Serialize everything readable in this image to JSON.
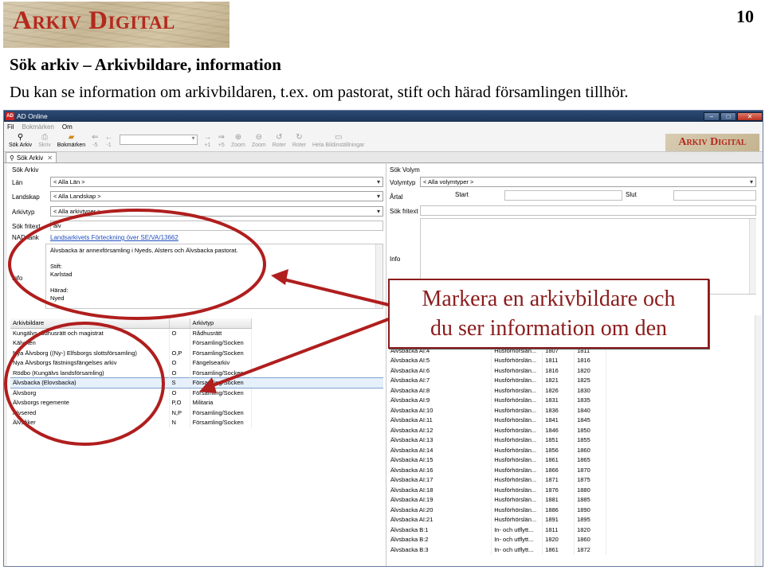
{
  "slide": {
    "logo_text": "Arkiv Digital",
    "page_number": "10",
    "title": "Sök arkiv – Arkivbildare, information",
    "subtitle": "Du kan se information om arkivbildaren, t.ex. om pastorat, stift och härad församlingen tillhör."
  },
  "window": {
    "title": "AD Online",
    "app_icon": "AD",
    "menu": [
      "Fil",
      "Bokmärken",
      "Om"
    ],
    "toolbar": {
      "sok_arkiv": "Sök Arkiv",
      "skriv": "Skriv",
      "bokmarken": "Bokmärken",
      "minus5": "-5",
      "minus1": "-1",
      "plus1": "+1",
      "plus5": "+5",
      "zoom_in": "Zoom",
      "zoom_out": "Zoom",
      "rotate_left": "Roter",
      "rotate_right": "Roter",
      "fit": "Hela Bildinställningar",
      "logo_text": "Arkiv Digital"
    },
    "tab_label": "Sök Arkiv",
    "sok_arkiv": {
      "section": "Sök Arkiv",
      "lan_label": "Län",
      "lan_value": "< Alla Län >",
      "landskap_label": "Landskap",
      "landskap_value": "< Alla Landskap >",
      "arkivtyp_label": "Arkivtyp",
      "arkivtyp_value": "< Alla arkivtyper >",
      "fritext_label": "Sök fritext",
      "fritext_value": "älv",
      "nad_label": "NAD länk",
      "nad_link": "Landsarkivets Förteckning över SE/VA/13662",
      "info_label": "Info",
      "info_line1": "Älvsbacka är annexförsamling i Nyeds, Alsters och Älvsbacka pastorat.",
      "stift_label": "Stift:",
      "stift_value": "Karlstad",
      "harad_label": "Härad:",
      "harad_value": "Nyed"
    },
    "arkiv_table": {
      "headers": [
        "Arkivbildare",
        "",
        "Arkivtyp"
      ],
      "rows": [
        [
          "Kungälvs rådhusrätt och magistrat",
          "O",
          "Rådhusrätt"
        ],
        [
          "Kälvsten",
          "",
          "Församling/Socken"
        ],
        [
          "Nya Älvsborg ((Ny-) Elfsborgs slottsförsamling)",
          "O,P",
          "Församling/Socken"
        ],
        [
          "Nya Älvsborgs fästningsfängelses arkiv",
          "O",
          "Fängelsearkiv"
        ],
        [
          "Rödbo (Kungälvs landsförsamling)",
          "O",
          "Församling/Socken"
        ],
        [
          "Älvsbacka (Elovsbacka)",
          "S",
          "Församling/Socken"
        ],
        [
          "Älvsborg",
          "O",
          "Församling/Socken"
        ],
        [
          "Älvsborgs regemente",
          "P,O",
          "Militaria"
        ],
        [
          "Älvsered",
          "N,P",
          "Församling/Socken"
        ],
        [
          "Älvsåker",
          "N",
          "Församling/Socken"
        ]
      ],
      "selected_index": 5
    },
    "sok_volym": {
      "section": "Sök Volym",
      "volymtyp_label": "Volymtyp",
      "volymtyp_value": "< Alla volymtyper >",
      "artal_label": "Årtal",
      "start_label": "Start",
      "slut_label": "Slut",
      "fritext_label": "Sök fritext",
      "info_label": "Info"
    },
    "volym_table": {
      "rows": [
        [
          "Älvsbacka AI:4",
          "Husförhörslän...",
          "1807",
          "1811"
        ],
        [
          "Älvsbacka AI:5",
          "Husförhörslän...",
          "1811",
          "1816"
        ],
        [
          "Älvsbacka AI:6",
          "Husförhörslän...",
          "1816",
          "1820"
        ],
        [
          "Älvsbacka AI:7",
          "Husförhörslän...",
          "1821",
          "1825"
        ],
        [
          "Älvsbacka AI:8",
          "Husförhörslän...",
          "1826",
          "1830"
        ],
        [
          "Älvsbacka AI:9",
          "Husförhörslän...",
          "1831",
          "1835"
        ],
        [
          "Älvsbacka AI:10",
          "Husförhörslän...",
          "1836",
          "1840"
        ],
        [
          "Älvsbacka AI:11",
          "Husförhörslän...",
          "1841",
          "1845"
        ],
        [
          "Älvsbacka AI:12",
          "Husförhörslän...",
          "1846",
          "1850"
        ],
        [
          "Älvsbacka AI:13",
          "Husförhörslän...",
          "1851",
          "1855"
        ],
        [
          "Älvsbacka AI:14",
          "Husförhörslän...",
          "1856",
          "1860"
        ],
        [
          "Älvsbacka AI:15",
          "Husförhörslän...",
          "1861",
          "1865"
        ],
        [
          "Älvsbacka AI:16",
          "Husförhörslän...",
          "1866",
          "1870"
        ],
        [
          "Älvsbacka AI:17",
          "Husförhörslän...",
          "1871",
          "1875"
        ],
        [
          "Älvsbacka AI:18",
          "Husförhörslän...",
          "1876",
          "1880"
        ],
        [
          "Älvsbacka AI:19",
          "Husförhörslän...",
          "1881",
          "1885"
        ],
        [
          "Älvsbacka AI:20",
          "Husförhörslän...",
          "1886",
          "1890"
        ],
        [
          "Älvsbacka AI:21",
          "Husförhörslän...",
          "1891",
          "1895"
        ],
        [
          "Älvsbacka B:1",
          "In- och utflytt...",
          "1811",
          "1820"
        ],
        [
          "Älvsbacka B:2",
          "In- och utflytt...",
          "1820",
          "1860"
        ],
        [
          "Älvsbacka B:3",
          "In- och utflytt...",
          "1861",
          "1872"
        ]
      ]
    }
  },
  "callout": {
    "line1": "Markera en arkivbildare och",
    "line2": "du ser information om den"
  },
  "colors": {
    "annotation": "#b01e1e",
    "logo_red": "#b4291d",
    "selection": "#e6f0fb"
  }
}
